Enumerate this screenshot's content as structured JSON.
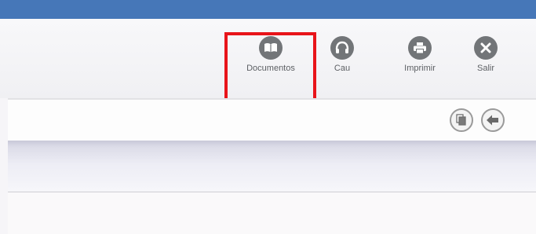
{
  "toolbar": {
    "documentos_label": "Documentos",
    "cau_label": "Cau",
    "imprimir_label": "Imprimir",
    "salir_label": "Salir"
  },
  "icons": {
    "documentos": "open-book-icon",
    "cau": "headset-icon",
    "imprimir": "printer-icon",
    "salir": "close-icon",
    "subbar_docs": "documents-icon",
    "subbar_back": "arrow-left-icon"
  },
  "colors": {
    "top_bar": "#4677b8",
    "icon_fill": "#727578",
    "highlight": "#e8141a"
  }
}
